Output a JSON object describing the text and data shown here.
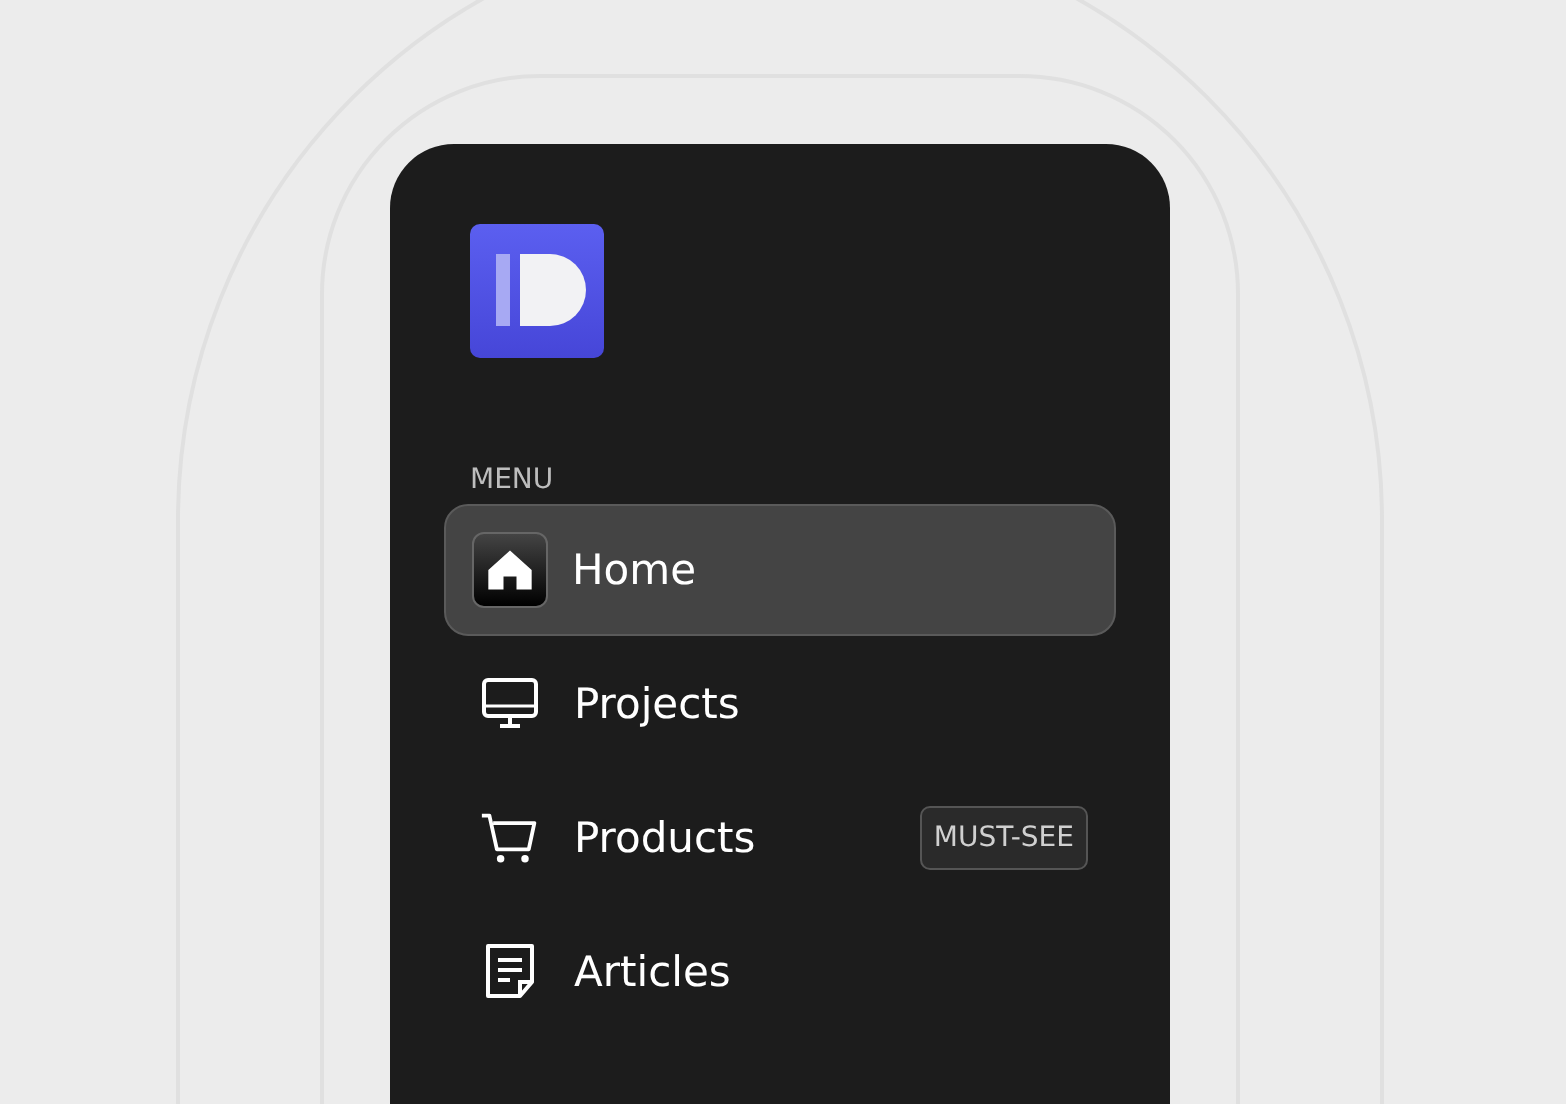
{
  "menu": {
    "heading": "MENU",
    "items": [
      {
        "label": "Home",
        "selected": true
      },
      {
        "label": "Projects",
        "selected": false
      },
      {
        "label": "Products",
        "selected": false,
        "badge": "MUST-SEE"
      },
      {
        "label": "Articles",
        "selected": false
      }
    ]
  }
}
